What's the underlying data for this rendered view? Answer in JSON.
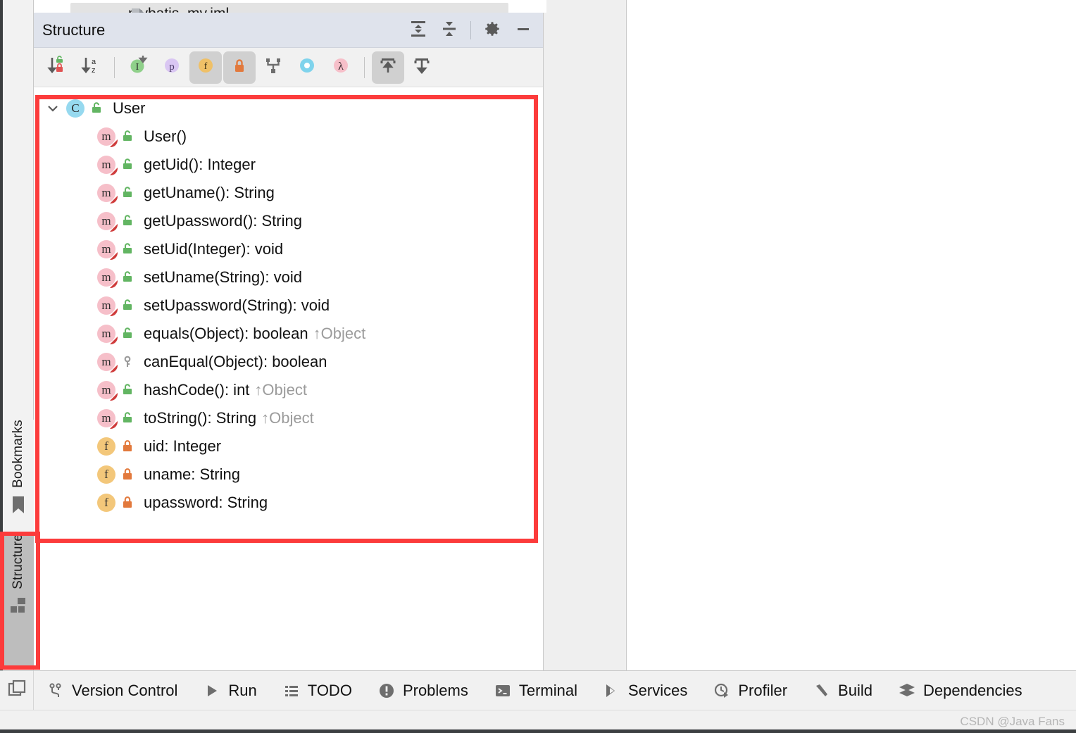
{
  "window": {
    "open_file_tab": {
      "label": "mybatis_my.iml",
      "icon": "file-icon"
    }
  },
  "tool_window": {
    "title": "Structure",
    "header_actions": [
      {
        "name": "expand-all",
        "label": "Expand All",
        "icon": "expand-all-icon"
      },
      {
        "name": "collapse-all",
        "label": "Collapse All",
        "icon": "collapse-all-icon"
      },
      {
        "name": "settings",
        "label": "Settings",
        "icon": "gear-icon"
      },
      {
        "name": "hide",
        "label": "Hide",
        "icon": "minimize-icon"
      }
    ],
    "toolbar": [
      {
        "name": "sort-by-visibility",
        "label": "Sort by Visibility",
        "icon": "sort-visibility-icon",
        "active": false
      },
      {
        "name": "sort-alphabetically",
        "label": "Sort Alphabetically",
        "icon": "sort-alpha-icon",
        "active": false
      },
      {
        "name": "show-inherited",
        "label": "Show Inherited",
        "icon": "inherited-icon",
        "active": false
      },
      {
        "name": "show-properties",
        "label": "Show Properties",
        "icon": "properties-icon",
        "active": false
      },
      {
        "name": "show-fields",
        "label": "Show Fields",
        "icon": "fields-icon",
        "active": true
      },
      {
        "name": "show-non-public",
        "label": "Show Non-Public",
        "icon": "lock-icon",
        "active": true
      },
      {
        "name": "group-methods-by-interface",
        "label": "Group Methods by Defining Type",
        "icon": "group-interface-icon",
        "active": false
      },
      {
        "name": "show-anonymous-classes",
        "label": "Show Anonymous Classes",
        "icon": "anonymous-class-icon",
        "active": false
      },
      {
        "name": "show-lambdas",
        "label": "Show Lambdas",
        "icon": "lambda-icon",
        "active": false
      },
      {
        "name": "autoscroll-to-source",
        "label": "Autoscroll to Source",
        "icon": "autoscroll-to-source-icon",
        "active": true
      },
      {
        "name": "autoscroll-from-source",
        "label": "Autoscroll from Source",
        "icon": "autoscroll-from-source-icon",
        "active": false
      }
    ],
    "tree": [
      {
        "level": 0,
        "expanded": true,
        "kind": "class",
        "kind_glyph": "C",
        "visibility": "public",
        "label": "User",
        "owner": ""
      },
      {
        "level": 1,
        "expanded": false,
        "kind": "method",
        "kind_glyph": "m",
        "visibility": "public",
        "label": "User()",
        "owner": ""
      },
      {
        "level": 1,
        "expanded": false,
        "kind": "method",
        "kind_glyph": "m",
        "visibility": "public",
        "label": "getUid(): Integer",
        "owner": ""
      },
      {
        "level": 1,
        "expanded": false,
        "kind": "method",
        "kind_glyph": "m",
        "visibility": "public",
        "label": "getUname(): String",
        "owner": ""
      },
      {
        "level": 1,
        "expanded": false,
        "kind": "method",
        "kind_glyph": "m",
        "visibility": "public",
        "label": "getUpassword(): String",
        "owner": ""
      },
      {
        "level": 1,
        "expanded": false,
        "kind": "method",
        "kind_glyph": "m",
        "visibility": "public",
        "label": "setUid(Integer): void",
        "owner": ""
      },
      {
        "level": 1,
        "expanded": false,
        "kind": "method",
        "kind_glyph": "m",
        "visibility": "public",
        "label": "setUname(String): void",
        "owner": ""
      },
      {
        "level": 1,
        "expanded": false,
        "kind": "method",
        "kind_glyph": "m",
        "visibility": "public",
        "label": "setUpassword(String): void",
        "owner": ""
      },
      {
        "level": 1,
        "expanded": false,
        "kind": "method",
        "kind_glyph": "m",
        "visibility": "public",
        "label": "equals(Object): boolean",
        "owner": "↑Object"
      },
      {
        "level": 1,
        "expanded": false,
        "kind": "method",
        "kind_glyph": "m",
        "visibility": "protected",
        "label": "canEqual(Object): boolean",
        "owner": ""
      },
      {
        "level": 1,
        "expanded": false,
        "kind": "method",
        "kind_glyph": "m",
        "visibility": "public",
        "label": "hashCode(): int",
        "owner": "↑Object"
      },
      {
        "level": 1,
        "expanded": false,
        "kind": "method",
        "kind_glyph": "m",
        "visibility": "public",
        "label": "toString(): String",
        "owner": "↑Object"
      },
      {
        "level": 1,
        "expanded": false,
        "kind": "field",
        "kind_glyph": "f",
        "visibility": "private",
        "label": "uid: Integer",
        "owner": ""
      },
      {
        "level": 1,
        "expanded": false,
        "kind": "field",
        "kind_glyph": "f",
        "visibility": "private",
        "label": "uname: String",
        "owner": ""
      },
      {
        "level": 1,
        "expanded": false,
        "kind": "field",
        "kind_glyph": "f",
        "visibility": "private",
        "label": "upassword: String",
        "owner": ""
      }
    ]
  },
  "tool_stripe": {
    "tabs": [
      {
        "name": "bookmarks",
        "label": "Bookmarks",
        "icon": "bookmark-icon",
        "selected": false
      },
      {
        "name": "structure",
        "label": "Structure",
        "icon": "structure-icon",
        "selected": true
      }
    ]
  },
  "bottom_bar": {
    "corner": {
      "name": "show-tool-windows",
      "icon": "windows-corner-icon"
    },
    "items": [
      {
        "label": "Version Control",
        "icon": "branch-icon"
      },
      {
        "label": "Run",
        "icon": "play-icon"
      },
      {
        "label": "TODO",
        "icon": "list-icon"
      },
      {
        "label": "Problems",
        "icon": "error-icon"
      },
      {
        "label": "Terminal",
        "icon": "terminal-icon"
      },
      {
        "label": "Services",
        "icon": "services-icon"
      },
      {
        "label": "Profiler",
        "icon": "profiler-icon"
      },
      {
        "label": "Build",
        "icon": "hammer-icon"
      },
      {
        "label": "Dependencies",
        "icon": "layers-icon"
      }
    ]
  },
  "status_bar": {
    "watermark": "CSDN @Java Fans"
  },
  "annotations": {
    "highlight_color": "#fc3b3b",
    "rects": [
      {
        "name": "structure-tree-highlight",
        "target": "structure tree contents"
      },
      {
        "name": "structure-tab-highlight",
        "target": "Structure tool window stripe button"
      }
    ]
  },
  "colors": {
    "header_bg": "#dfe3ec",
    "toolbar_bg": "#f1f1f1",
    "tree_bg": "#ffffff",
    "class_icon": "#96d9ef",
    "method_icon": "#f6bfc9",
    "field_icon": "#f3c77a",
    "public_lock": "#62b562",
    "private_lock": "#e8883f",
    "owner_text": "#9b9b9b",
    "selected_tab_bg": "#bdbdbd"
  }
}
